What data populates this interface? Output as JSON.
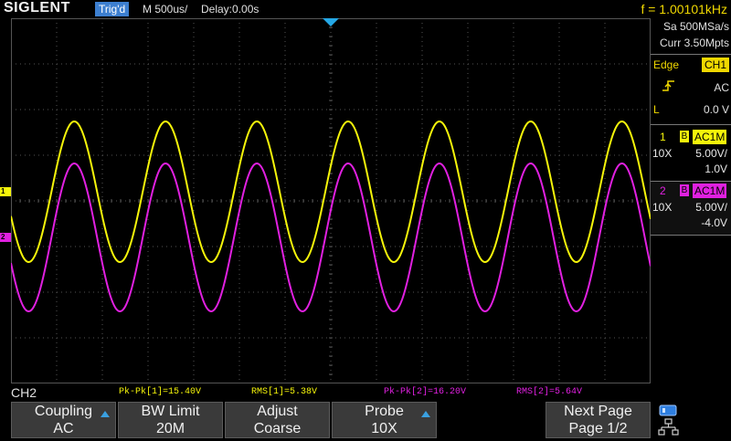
{
  "header": {
    "brand": "SIGLENT",
    "trigger_status": "Trig'd",
    "timebase": "M 500us/",
    "delay": "Delay:0.00s",
    "frequency": "f = 1.00101kHz"
  },
  "acquisition": {
    "sample_rate": "Sa 500MSa/s",
    "memory_depth": "Curr 3.50Mpts"
  },
  "trigger": {
    "type_label": "Edge",
    "source": "CH1",
    "slope_icon": "rising-edge-icon",
    "coupling": "AC",
    "level_label": "L",
    "level_value": "0.0 V"
  },
  "channels": [
    {
      "number": "1",
      "bw_badge": "B",
      "coupling": "AC1M",
      "probe": "10X",
      "scale": "5.00V/",
      "offset": "1.0V",
      "color": "#f5f50a",
      "marker": "1"
    },
    {
      "number": "2",
      "bw_badge": "B",
      "coupling": "AC1M",
      "probe": "10X",
      "scale": "5.00V/",
      "offset": "-4.0V",
      "color": "#e020e0",
      "marker": "2"
    }
  ],
  "measurements": {
    "active_channel": "CH2",
    "items": [
      {
        "text": "Pk-Pk[1]=15.40V",
        "color": "#f5f50a"
      },
      {
        "text": "RMS[1]=5.38V",
        "color": "#f5f50a"
      },
      {
        "text": "Pk-Pk[2]=16.20V",
        "color": "#e020e0"
      },
      {
        "text": "RMS[2]=5.64V",
        "color": "#e020e0"
      }
    ]
  },
  "softkeys": [
    {
      "line1": "Coupling",
      "line2": "AC",
      "has_arrow": true
    },
    {
      "line1": "BW Limit",
      "line2": "20M",
      "has_arrow": false
    },
    {
      "line1": "Adjust",
      "line2": "Coarse",
      "has_arrow": false
    },
    {
      "line1": "Probe",
      "line2": "10X",
      "has_arrow": true
    },
    {
      "line1": "Next Page",
      "line2": "Page 1/2",
      "has_arrow": false
    }
  ],
  "system_icons": [
    "storage-icon",
    "network-icon"
  ],
  "colors": {
    "ch1": "#f5f50a",
    "ch2": "#e020e0",
    "accent": "#3d7fd0",
    "grid": "#555555"
  },
  "waveforms": {
    "frequency_hz": 1001.01,
    "time_per_div_s": 0.0005,
    "volts_per_div": 5.0,
    "ch1": {
      "amplitude_pk_v": 7.7,
      "offset_v": 1.0
    },
    "ch2": {
      "amplitude_pk_v": 8.1,
      "offset_v": -4.0
    }
  }
}
